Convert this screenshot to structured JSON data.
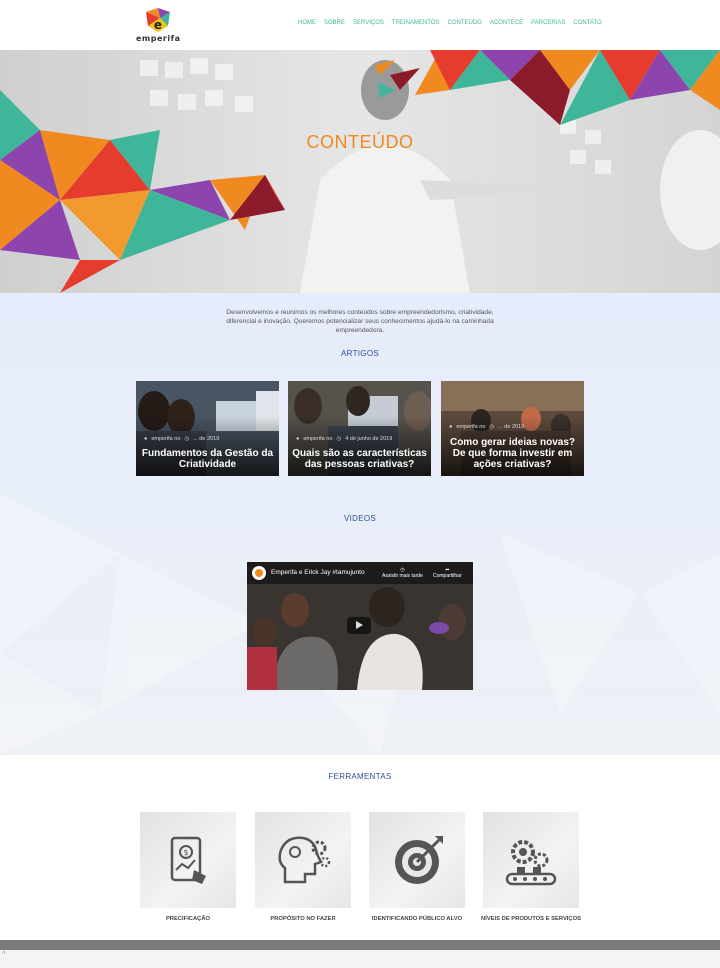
{
  "brand": {
    "name": "emperifa"
  },
  "nav": [
    "HOME",
    "SOBRE",
    "SERVIÇOS",
    "TREINAMENTOS",
    "CONTEÚDO",
    "ACONTECE",
    "PARCERIAS",
    "CONTATO"
  ],
  "hero": {
    "title": "CONTEÚDO"
  },
  "intro": "Desenvolvemos e reunimos os melhores conteúdos sobre empreendedorismo, criatividade, diferencial e inovação. Queremos potencializar seus conhecimentos ajudá-lo na caminhada empreendedora.",
  "sections": {
    "articles": "ARTIGOS",
    "videos": "VIDEOS",
    "tools": "FERRAMENTAS"
  },
  "articles": [
    {
      "author": "emperifa no",
      "date": "... de 2019",
      "title": "Fundamentos da Gestão da Criatividade"
    },
    {
      "author": "emperifa no",
      "date": "4 de junho de 2019",
      "title": "Quais são as características das pessoas criativas?"
    },
    {
      "author": "emperifa no",
      "date": "... de 2019",
      "title": "Como gerar ideias novas? De que forma investir em ações criativas?"
    }
  ],
  "video": {
    "title": "Emperifa e Erick Jay #tamujunto",
    "watch_later": "Assistir mais tarde",
    "share": "Compartilhar"
  },
  "tools": [
    {
      "label": "PRECIFICAÇÃO",
      "icon": "tablet-money-icon"
    },
    {
      "label": "PROPÓSITO NO FAZER",
      "icon": "head-gears-icon"
    },
    {
      "label": "IDENTIFICANDO PÚBLICO ALVO",
      "icon": "target-icon"
    },
    {
      "label": "NÍVEIS DE PRODUTOS E SERVIÇOS",
      "icon": "conveyor-gears-icon"
    }
  ],
  "colors": {
    "accent_orange": "#f08a20",
    "nav_green": "#3fb59a",
    "section_blue": "#2d4f9a"
  }
}
